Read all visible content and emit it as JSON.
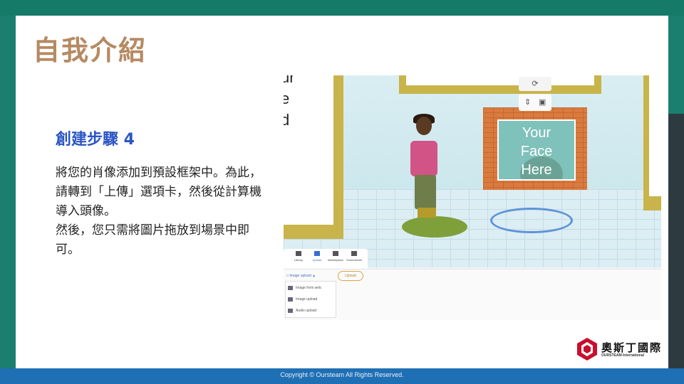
{
  "slide": {
    "title": "自我介紹",
    "subtitle": "創建步驟 4",
    "paragraphs": [
      "將您的肖像添加到預設框架中。為此，請轉到「上傳」選項卡，然後從計算機導入頭像。",
      "然後，您只需將圖片拖放到場景中即可。"
    ],
    "footer": "Copyright © Oursteam All Rights Reserved."
  },
  "screenshot": {
    "frame_left_text": "ur\ne\nd",
    "face_text": "Your\nFace\nHere",
    "toolbar": [
      "Library",
      "Upload",
      "Marketplace",
      "Screenshots"
    ],
    "upload_dropdown": "Image upload",
    "upload_button": "Upload",
    "menu_items": [
      "Image from web",
      "Image upload",
      "Audio upload"
    ]
  },
  "logo": {
    "name_cn": "奧斯丁國際",
    "name_en": "OURSTEAM International"
  },
  "colors": {
    "title": "#b58a63",
    "subtitle": "#2b55c4",
    "footer_bar": "#1f6fb4",
    "frame_teal": "#1a7f6e"
  }
}
